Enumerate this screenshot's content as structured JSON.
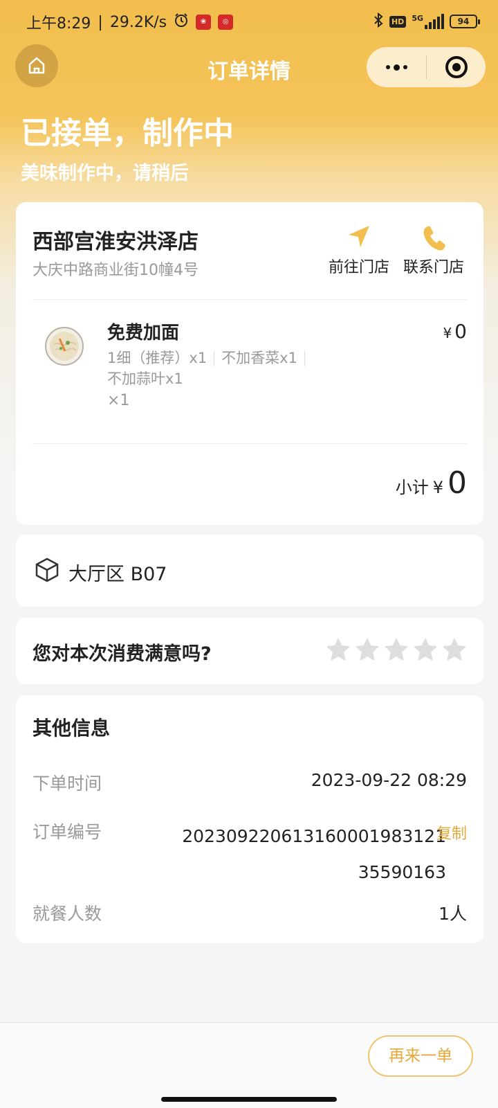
{
  "status_bar": {
    "time": "上午8:29",
    "net_speed": "29.2K/s",
    "network": "5G",
    "hd_label": "HD",
    "battery": "94"
  },
  "nav": {
    "title": "订单详情"
  },
  "order_status": {
    "title": "已接单，制作中",
    "subtitle": "美味制作中，请稍后"
  },
  "store": {
    "name": "西部宫淮安洪泽店",
    "address": "大庆中路商业街10幢4号",
    "go_label": "前往门店",
    "contact_label": "联系门店"
  },
  "item": {
    "name": "免费加面",
    "price_symbol": "¥",
    "price": "0",
    "spec_1": "1细（推荐）x1",
    "spec_2": "不加香菜x1",
    "spec_3": "不加蒜叶x1",
    "quantity": "×1"
  },
  "subtotal": {
    "label": "小计",
    "symbol": "¥",
    "value": "0"
  },
  "table": {
    "label": "大厅区 B07"
  },
  "rating": {
    "question": "您对本次消费满意吗?",
    "stars_total": 5,
    "stars_filled": 0
  },
  "info": {
    "title": "其他信息",
    "order_time_label": "下单时间",
    "order_time": "2023-09-22 08:29",
    "order_no_label": "订单编号",
    "order_no": "2023092206131600019831213559 0163",
    "copy_label": "复制",
    "diners_label": "就餐人数",
    "diners": "1人"
  },
  "footer": {
    "reorder_label": "再来一单"
  },
  "colors": {
    "accent": "#f2be4d",
    "accent_text": "#e6a83b"
  }
}
